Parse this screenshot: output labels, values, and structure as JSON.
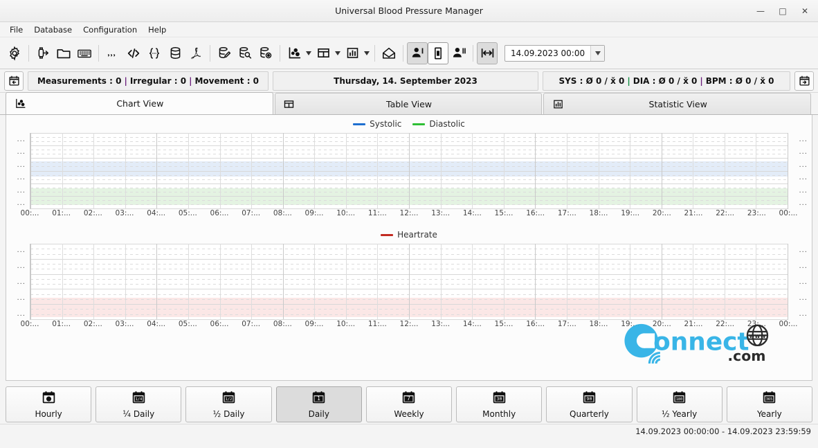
{
  "window": {
    "title": "Universal Blood Pressure Manager",
    "minimize_label": "—",
    "maximize_label": "□",
    "close_label": "✕"
  },
  "menu": {
    "items": [
      {
        "label": "File",
        "name": "menu-file"
      },
      {
        "label": "Database",
        "name": "menu-database"
      },
      {
        "label": "Configuration",
        "name": "menu-configuration"
      },
      {
        "label": "Help",
        "name": "menu-help"
      }
    ]
  },
  "toolbar": {
    "date_value": "14.09.2023 00:00",
    "buttons": [
      {
        "name": "settings-gear-icon",
        "icon": "gear"
      },
      {
        "name": "import-device-icon",
        "icon": "device-arrow"
      },
      {
        "name": "open-folder-icon",
        "icon": "folder"
      },
      {
        "name": "keyboard-entry-icon",
        "icon": "keyboard"
      },
      {
        "name": "csv-export-icon",
        "icon": "commas"
      },
      {
        "name": "xml-export-icon",
        "icon": "angle-brackets"
      },
      {
        "name": "json-export-icon",
        "icon": "curly-braces"
      },
      {
        "name": "sql-export-icon",
        "icon": "database"
      },
      {
        "name": "pdf-export-icon",
        "icon": "pdf"
      },
      {
        "name": "database-edit-icon",
        "icon": "db-pencil"
      },
      {
        "name": "database-search-icon",
        "icon": "db-search"
      },
      {
        "name": "database-view-icon",
        "icon": "db-eye"
      },
      {
        "name": "chart-view-icon",
        "icon": "scatter"
      },
      {
        "name": "table-view-icon",
        "icon": "table"
      },
      {
        "name": "statistic-view-icon",
        "icon": "bars"
      },
      {
        "name": "mail-icon",
        "icon": "envelope"
      },
      {
        "name": "single-user-icon",
        "icon": "user-one"
      },
      {
        "name": "both-arms-icon",
        "icon": "arm-cuff"
      },
      {
        "name": "multi-user-icon",
        "icon": "user-two"
      },
      {
        "name": "fit-width-icon",
        "icon": "fit-width"
      }
    ]
  },
  "infobar": {
    "prev_day_icon": "calendar-back",
    "next_day_icon": "calendar-forward",
    "counts": {
      "measurements_label": "Measurements : 0",
      "irregular_label": "Irregular : 0",
      "movement_label": "Movement : 0"
    },
    "date_label": "Thursday, 14. September 2023",
    "stats": {
      "sys_label": "SYS : Ø 0 / x̌ 0",
      "dia_label": "DIA : Ø 0 / x̌ 0",
      "bpm_label": "BPM : Ø 0 / x̌ 0"
    }
  },
  "tabs": [
    {
      "label": "Chart View",
      "name": "tab-chart-view",
      "icon": "scatter",
      "selected": true
    },
    {
      "label": "Table View",
      "name": "tab-table-view",
      "icon": "table",
      "selected": false
    },
    {
      "label": "Statistic View",
      "name": "tab-statistic-view",
      "icon": "bars",
      "selected": false
    }
  ],
  "chart_data": [
    {
      "type": "line",
      "title": "",
      "name": "blood-pressure-chart",
      "series": [
        {
          "name": "Systolic",
          "color": "#1f6fd0",
          "values": []
        },
        {
          "name": "Diastolic",
          "color": "#2fbf35",
          "values": []
        }
      ],
      "x": [
        "00:...",
        "01:...",
        "02:...",
        "03:...",
        "04:...",
        "05:...",
        "06:...",
        "07:...",
        "08:...",
        "09:...",
        "10:...",
        "11:...",
        "12:...",
        "13:...",
        "14:...",
        "15:...",
        "16:...",
        "17:...",
        "18:...",
        "19:...",
        "20:...",
        "21:...",
        "22:...",
        "23:...",
        "00:..."
      ],
      "xlabel": "",
      "ylabel": "",
      "ytick_labels": [
        "...",
        "...",
        "...",
        "...",
        "...",
        "..."
      ],
      "grid": true,
      "legend_position": "top",
      "bands": [
        {
          "name": "systolic-normal-band",
          "color": "#e3ecf8"
        },
        {
          "name": "diastolic-normal-band",
          "color": "#e4f3e2"
        }
      ]
    },
    {
      "type": "line",
      "title": "",
      "name": "heartrate-chart",
      "series": [
        {
          "name": "Heartrate",
          "color": "#c22b22",
          "values": []
        }
      ],
      "x": [
        "00:...",
        "01:...",
        "02:...",
        "03:...",
        "04:...",
        "05:...",
        "06:...",
        "07:...",
        "08:...",
        "09:...",
        "10:...",
        "11:...",
        "12:...",
        "13:...",
        "14:...",
        "15:...",
        "16:...",
        "17:...",
        "18:...",
        "19:...",
        "20:...",
        "21:...",
        "22:...",
        "23:...",
        "00:..."
      ],
      "xlabel": "",
      "ylabel": "",
      "ytick_labels": [
        "...",
        "...",
        "...",
        "...",
        "..."
      ],
      "grid": true,
      "legend_position": "top",
      "bands": [
        {
          "name": "heartrate-normal-band",
          "color": "#fbe7e6"
        }
      ]
    }
  ],
  "watermark": {
    "text_main": "onnect",
    "text_c": "C",
    "text_com": "com",
    "text_www": "www",
    "color": "#29b0e6"
  },
  "range_buttons": [
    {
      "label": "Hourly",
      "glyph": "●",
      "name": "range-hourly",
      "selected": false
    },
    {
      "label": "¼ Daily",
      "glyph": "1/4",
      "name": "range-quarter-daily",
      "selected": false
    },
    {
      "label": "½ Daily",
      "glyph": "1/2",
      "name": "range-half-daily",
      "selected": false
    },
    {
      "label": "Daily",
      "glyph": "1",
      "name": "range-daily",
      "selected": true
    },
    {
      "label": "Weekly",
      "glyph": "7",
      "name": "range-weekly",
      "selected": false
    },
    {
      "label": "Monthly",
      "glyph": "30",
      "name": "range-monthly",
      "selected": false
    },
    {
      "label": "Quarterly",
      "glyph": "90",
      "name": "range-quarterly",
      "selected": false
    },
    {
      "label": "½ Yearly",
      "glyph": "180",
      "name": "range-half-yearly",
      "selected": false
    },
    {
      "label": "Yearly",
      "glyph": "365",
      "name": "range-yearly",
      "selected": false
    }
  ],
  "statusbar": {
    "range_text": "14.09.2023 00:00:00 - 14.09.2023 23:59:59"
  }
}
